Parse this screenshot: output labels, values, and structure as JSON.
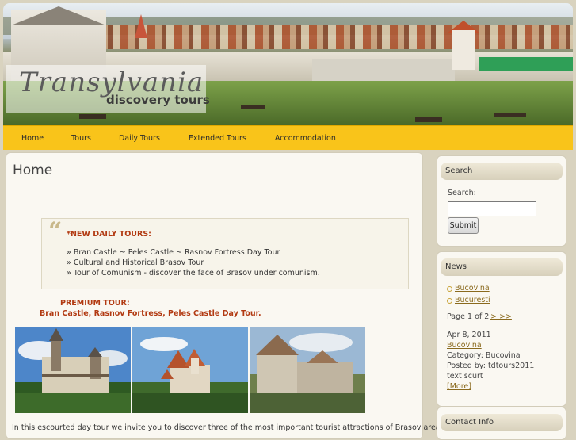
{
  "header": {
    "title": "Transylvania",
    "subtitle": "discovery tours"
  },
  "nav": {
    "items": [
      "Home",
      "Tours",
      "Daily Tours",
      "Extended Tours",
      "Accommodation"
    ]
  },
  "main": {
    "heading": "Home",
    "quote": {
      "title": "*NEW DAILY TOURS:",
      "items": [
        "» Bran Castle ~ Peles Castle ~ Rasnov Fortress Day Tour",
        "» Cultural and Historical Brasov Tour",
        "» Tour of Comunism - discover the face of Brasov under comunism."
      ]
    },
    "premium_label": "PREMIUM TOUR:",
    "premium_title": "Bran Castle, Rasnov Fortress, Peles Castle Day Tour.",
    "intro": "In this escourted day tour we invite you to discover three of the most important tourist attractions of Brasov area wich"
  },
  "sidebar": {
    "search": {
      "heading": "Search",
      "label": "Search:",
      "value": "",
      "button": "Submit"
    },
    "news": {
      "heading": "News",
      "items": [
        "Bucovina",
        "Bucuresti"
      ],
      "pager_text": "Page 1 of 2",
      "pager_link": "> >>",
      "date": "Apr 8, 2011",
      "post_title": "Bucovina",
      "category": "Category: Bucovina",
      "posted_by": "Posted by: tdtours2011",
      "excerpt": "text scurt",
      "more": "[More]"
    },
    "contact": {
      "heading": "Contact Info"
    }
  },
  "colors": {
    "nav_bg": "#f9c41a",
    "accent_red": "#b23a12",
    "link": "#8a6a1e"
  }
}
